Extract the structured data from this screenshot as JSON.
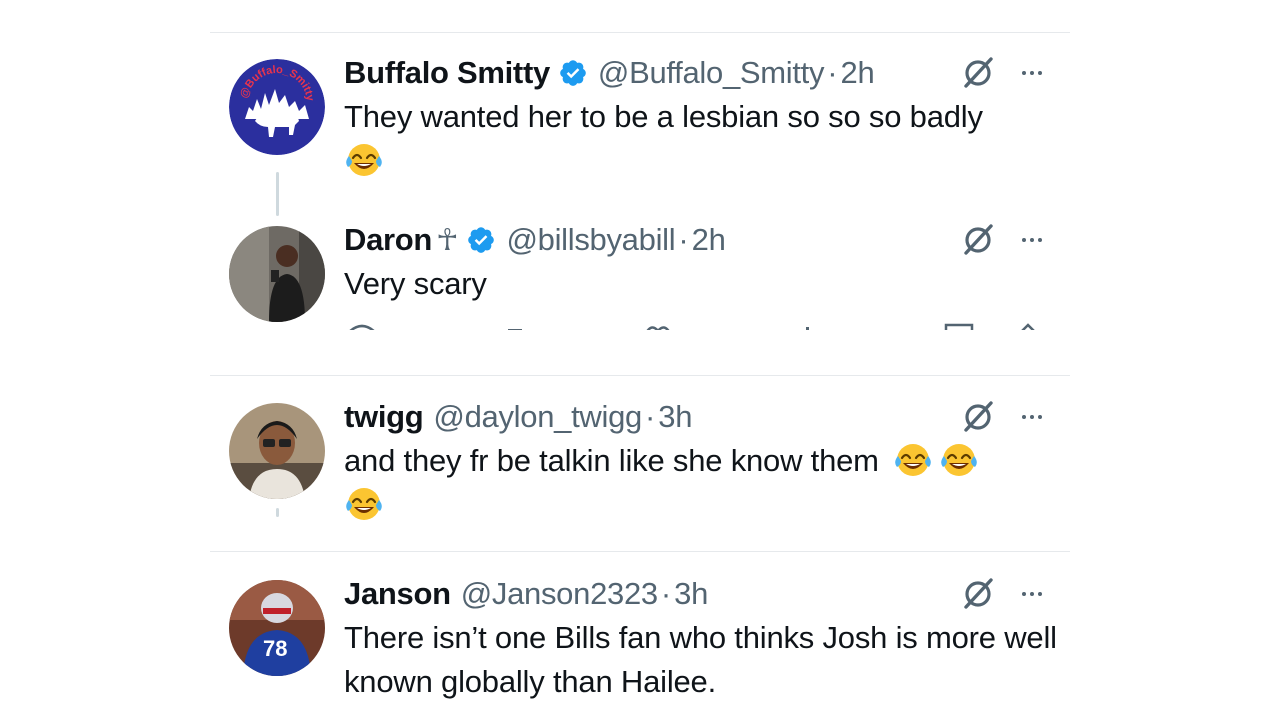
{
  "tweets": [
    {
      "name": "Buffalo Smitty",
      "verified": true,
      "handle": "@Buffalo_Smitty",
      "separator": "·",
      "time": "2h",
      "text": "They wanted her to be a lesbian so so so badly",
      "avatar_text": "@Buffalo_Smitty",
      "emoji_after": [
        "laughing-tears"
      ]
    },
    {
      "name": "Daron",
      "name_symbol": "☥",
      "verified": true,
      "handle": "@billsbyabill",
      "separator": "·",
      "time": "2h",
      "text": "Very scary"
    },
    {
      "name": "twigg",
      "verified": false,
      "handle": "@daylon_twigg",
      "separator": "·",
      "time": "3h",
      "text": "and they fr be talkin like she know them",
      "emoji_after": [
        "laughing-tears",
        "laughing-tears",
        "laughing-tears"
      ]
    },
    {
      "name": "Janson",
      "verified": false,
      "handle": "@Janson2323",
      "separator": "·",
      "time": "3h",
      "text": "There isn’t one Bills fan who thinks Josh is more well known globally than Hailee.",
      "avatar_text": "78"
    }
  ],
  "icons": {
    "verified": "verified-badge-icon",
    "grok": "grok-icon",
    "more": "more-icon",
    "emoji": "face-with-tears-of-joy"
  },
  "colors": {
    "text": "#0f1419",
    "secondary": "#536471",
    "verified": "#1d9bf0",
    "divider": "#e6e9ec",
    "buffalo_avatar": "#2b2f9e"
  }
}
